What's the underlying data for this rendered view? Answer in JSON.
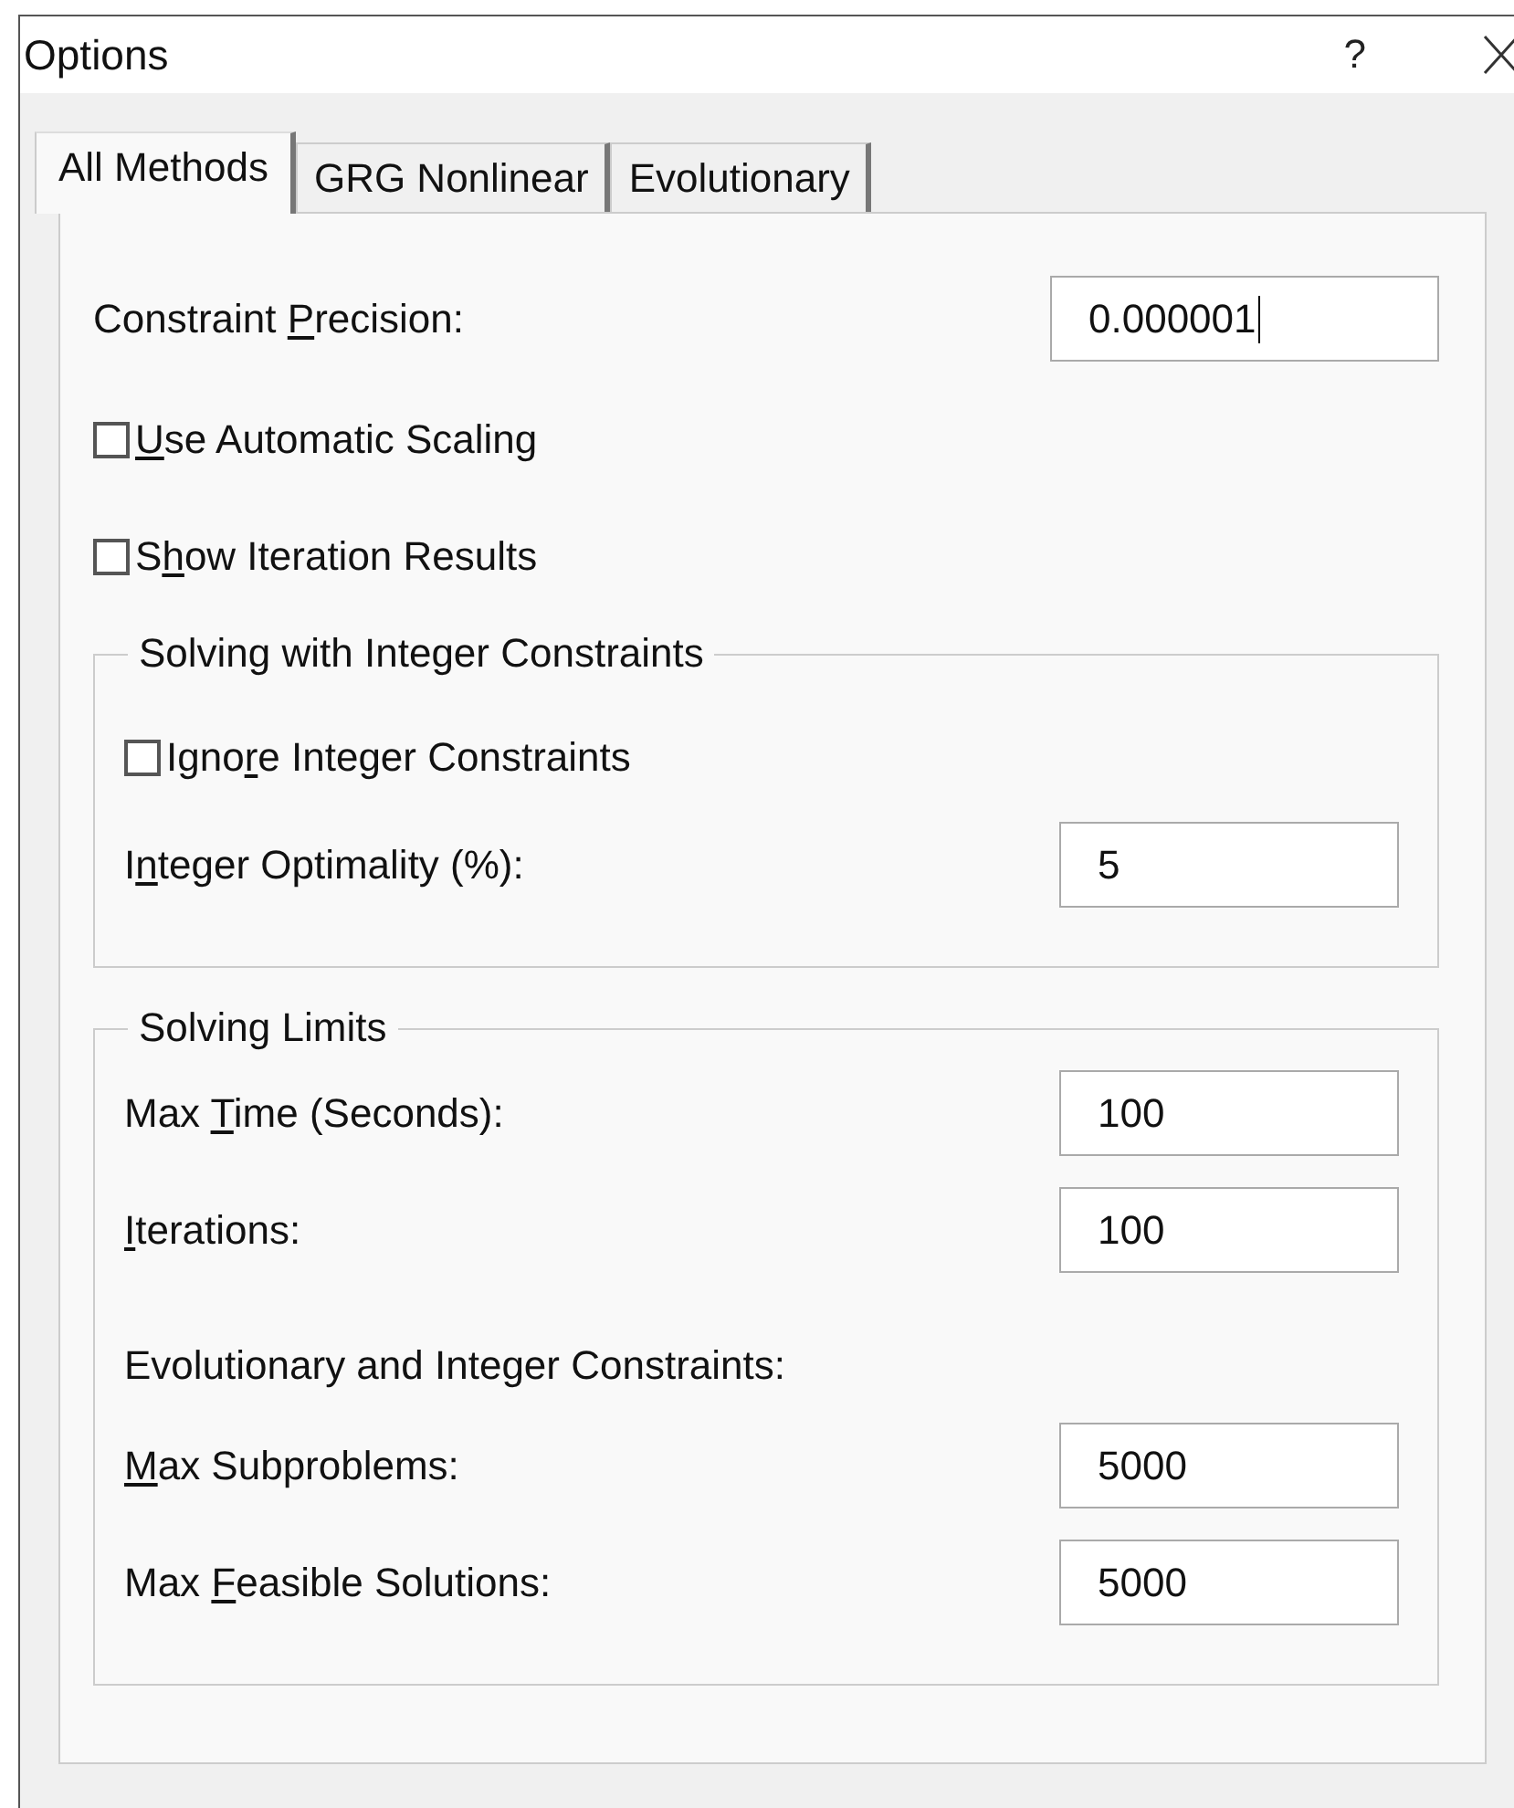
{
  "window": {
    "title": "Options",
    "help": "?"
  },
  "tabs": [
    {
      "label": "All Methods",
      "selected": true
    },
    {
      "label": "GRG Nonlinear",
      "selected": false
    },
    {
      "label": "Evolutionary",
      "selected": false
    }
  ],
  "items": [
    {
      "kind": "field",
      "label": {
        "pre": "Constraint ",
        "key": "P",
        "post": "recision:"
      },
      "value": "0.000001",
      "focused": true
    },
    {
      "kind": "checkbox",
      "label": {
        "key": "U",
        "post": "se Automatic Scaling"
      },
      "checked": false
    },
    {
      "kind": "checkbox",
      "label": {
        "pre": "S",
        "key": "h",
        "post": "ow Iteration Results"
      },
      "checked": false
    },
    {
      "kind": "group",
      "title": "Solving with Integer Constraints",
      "children": [
        {
          "kind": "checkbox",
          "label": {
            "pre": "Igno",
            "key": "r",
            "post": "e Integer Constraints"
          },
          "checked": false
        },
        {
          "kind": "field",
          "label": {
            "pre": "I",
            "key": "n",
            "post": "teger Optimality (%):"
          },
          "value": "5",
          "focused": false
        }
      ]
    },
    {
      "kind": "group",
      "title": "Solving Limits",
      "children": [
        {
          "kind": "field",
          "label": {
            "pre": "Max ",
            "key": "T",
            "post": "ime (Seconds):"
          },
          "value": "100",
          "focused": false
        },
        {
          "kind": "field",
          "label": {
            "key": "I",
            "post": "terations:"
          },
          "value": "100",
          "focused": false
        },
        {
          "kind": "text",
          "text": "Evolutionary and Integer Constraints:"
        },
        {
          "kind": "field",
          "label": {
            "key": "M",
            "post": "ax Subproblems:"
          },
          "value": "5000",
          "focused": false
        },
        {
          "kind": "field",
          "label": {
            "pre": "Max ",
            "key": "F",
            "post": "easible Solutions:"
          },
          "value": "5000",
          "focused": false
        }
      ]
    }
  ]
}
